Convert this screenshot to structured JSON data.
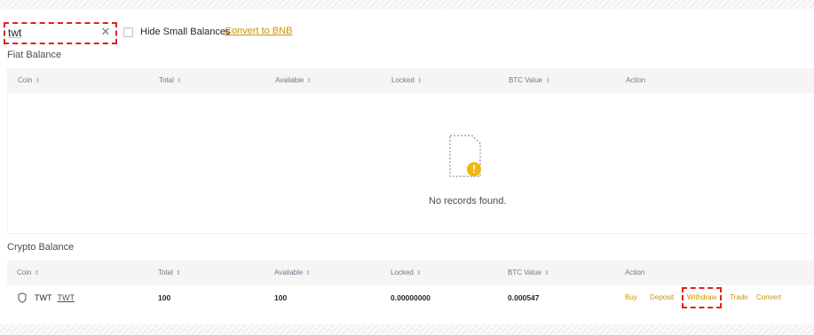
{
  "search": {
    "value": "twt"
  },
  "filters": {
    "hide_small_label": "Hide Small Balances",
    "convert_link": "Convert to BNB"
  },
  "fiat": {
    "title": "Fiat Balance",
    "columns": [
      "Coin",
      "Total",
      "Available",
      "Locked",
      "BTC Value",
      "Action"
    ],
    "empty_text": "No records found."
  },
  "crypto": {
    "title": "Crypto Balance",
    "columns": [
      "Coin",
      "Total",
      "Available",
      "Locked",
      "BTC Value",
      "Action"
    ],
    "rows": [
      {
        "symbol": "TWT",
        "name": "TWT",
        "total": "100",
        "available": "100",
        "locked": "0.00000000",
        "btc_value": "0.000547",
        "actions": [
          "Buy",
          "Deposit",
          "Withdraw",
          "Trade",
          "Convert"
        ]
      }
    ]
  },
  "icons": {
    "clear": "close-icon",
    "coin": "shield-icon",
    "empty": "empty-document-icon",
    "sort": "sort-icon"
  },
  "colors": {
    "accent": "#c99400",
    "empty_badge": "#f0b90b",
    "highlight": "#e02020"
  }
}
